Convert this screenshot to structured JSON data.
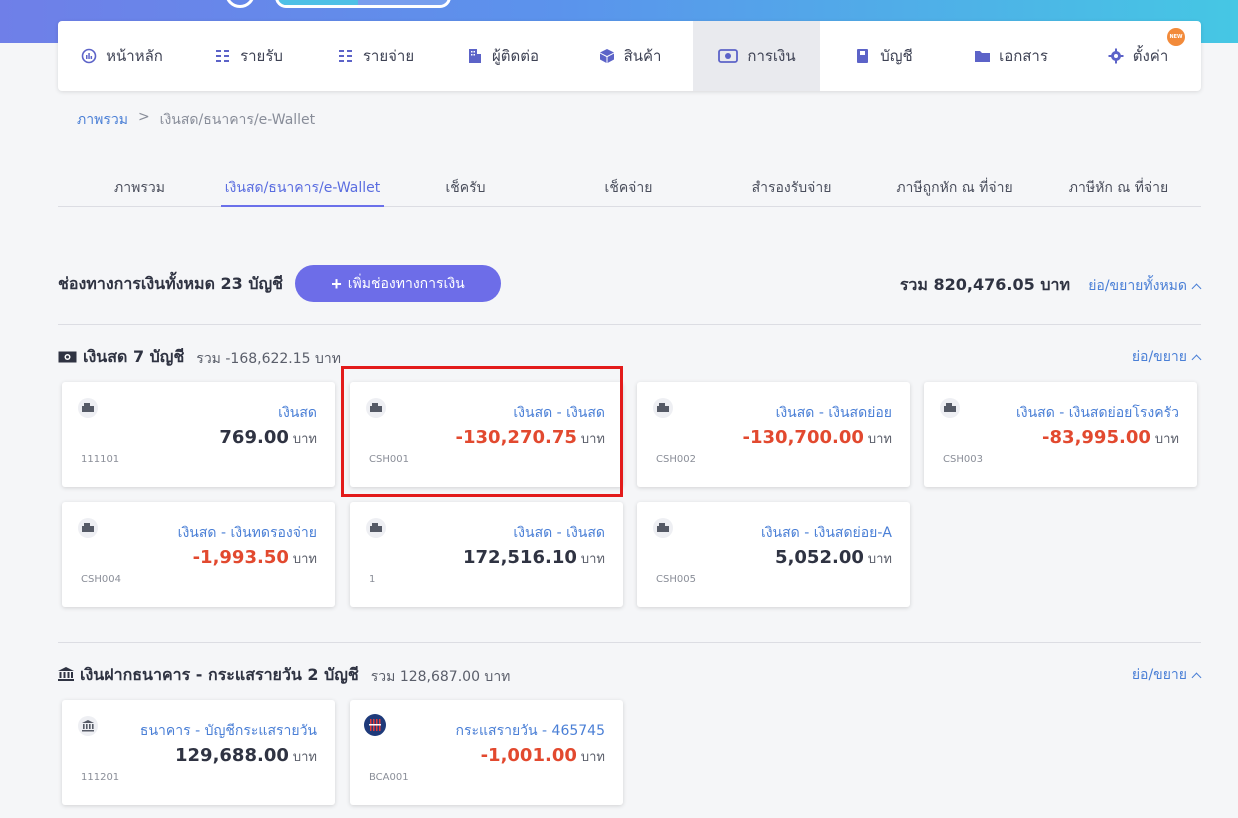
{
  "nav": {
    "items": [
      {
        "label": "หน้าหลัก",
        "icon": "dashboard-icon"
      },
      {
        "label": "รายรับ",
        "icon": "income-icon"
      },
      {
        "label": "รายจ่าย",
        "icon": "expense-icon"
      },
      {
        "label": "ผู้ติดต่อ",
        "icon": "contacts-icon"
      },
      {
        "label": "สินค้า",
        "icon": "box-icon"
      },
      {
        "label": "การเงิน",
        "icon": "money-icon"
      },
      {
        "label": "บัญชี",
        "icon": "ledger-icon"
      },
      {
        "label": "เอกสาร",
        "icon": "folder-icon"
      },
      {
        "label": "ตั้งค่า",
        "icon": "gear-icon"
      }
    ],
    "active_index": 5,
    "new_badge": "NEW"
  },
  "breadcrumb": {
    "root": "ภาพรวม",
    "separator": ">",
    "current": "เงินสด/ธนาคาร/e-Wallet"
  },
  "tabs": [
    {
      "label": "ภาพรวม"
    },
    {
      "label": "เงินสด/ธนาคาร/e-Wallet"
    },
    {
      "label": "เช็ครับ"
    },
    {
      "label": "เช็คจ่าย"
    },
    {
      "label": "สำรองรับจ่าย"
    },
    {
      "label": "ภาษีถูกหัก ณ ที่จ่าย"
    },
    {
      "label": "ภาษีหัก ณ ที่จ่าย"
    }
  ],
  "summary": {
    "title": "ช่องทางการเงินทั้งหมด 23 บัญชี",
    "add_button": "เพิ่มช่องทางการเงิน",
    "total": "รวม 820,476.05 บาท",
    "collapse_all": "ย่อ/ขยายทั้งหมด"
  },
  "groups": [
    {
      "title": "เงินสด 7 บัญชี",
      "sum": "รวม -168,622.15 บาท",
      "toggle": "ย่อ/ขยาย",
      "icon": "cash-icon",
      "cards": [
        {
          "name": "เงินสด",
          "amount": "769.00",
          "unit": "บาท",
          "code": "111101",
          "negative": false,
          "icon": "cash-register-icon"
        },
        {
          "name": "เงินสด - เงินสด",
          "amount": "-130,270.75",
          "unit": "บาท",
          "code": "CSH001",
          "negative": true,
          "icon": "cash-register-icon"
        },
        {
          "name": "เงินสด - เงินสดย่อย",
          "amount": "-130,700.00",
          "unit": "บาท",
          "code": "CSH002",
          "negative": true,
          "icon": "cash-register-icon"
        },
        {
          "name": "เงินสด - เงินสดย่อยโรงครัว",
          "amount": "-83,995.00",
          "unit": "บาท",
          "code": "CSH003",
          "negative": true,
          "icon": "cash-register-icon"
        },
        {
          "name": "เงินสด - เงินทดรองจ่าย",
          "amount": "-1,993.50",
          "unit": "บาท",
          "code": "CSH004",
          "negative": true,
          "icon": "cash-register-icon"
        },
        {
          "name": "เงินสด - เงินสด",
          "amount": "172,516.10",
          "unit": "บาท",
          "code": "1",
          "negative": false,
          "icon": "cash-register-icon"
        },
        {
          "name": "เงินสด - เงินสดย่อย-A",
          "amount": "5,052.00",
          "unit": "บาท",
          "code": "CSH005",
          "negative": false,
          "icon": "cash-register-icon"
        }
      ]
    },
    {
      "title": "เงินฝากธนาคาร - กระแสรายวัน 2 บัญชี",
      "sum": "รวม 128,687.00 บาท",
      "toggle": "ย่อ/ขยาย",
      "icon": "bank-icon",
      "cards": [
        {
          "name": "ธนาคาร - บัญชีกระแสรายวัน",
          "amount": "129,688.00",
          "unit": "บาท",
          "code": "111201",
          "negative": false,
          "icon": "bank-icon"
        },
        {
          "name": "กระแสรายวัน - 465745",
          "amount": "-1,001.00",
          "unit": "บาท",
          "code": "BCA001",
          "negative": true,
          "icon": "bank-logo-icon"
        }
      ]
    }
  ],
  "colors": {
    "accent": "#6d6de8",
    "link": "#4a7fd6",
    "negative": "#e2492f",
    "highlight": "#e31b1b"
  }
}
